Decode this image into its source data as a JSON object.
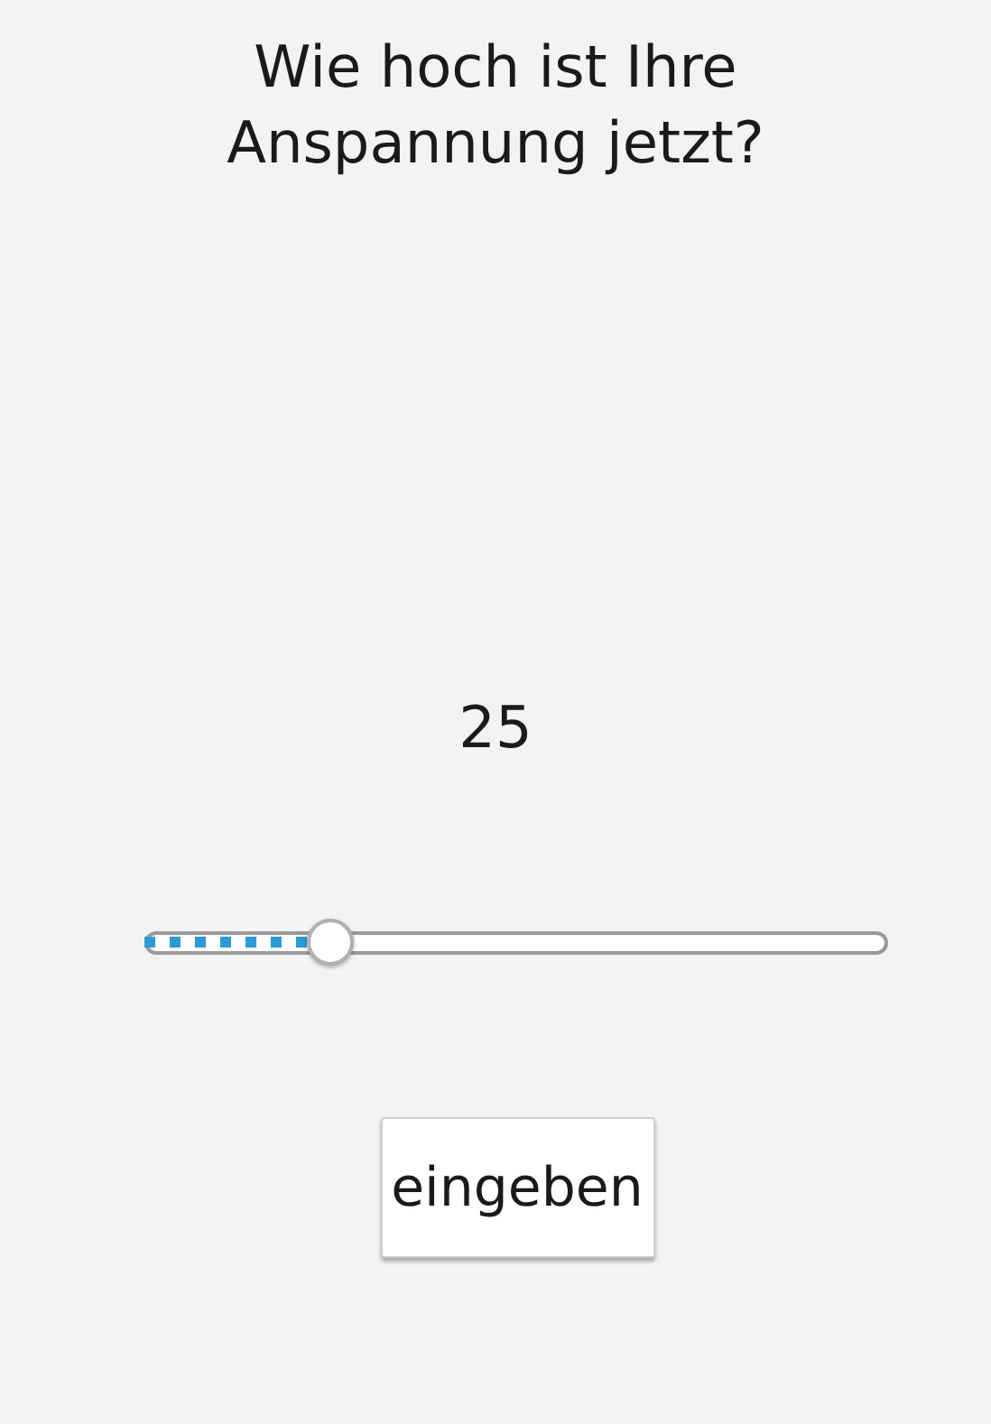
{
  "question": "Wie hoch ist Ihre Anspannung jetzt?",
  "value": "25",
  "slider": {
    "level": 0.25
  },
  "button": "eingeben"
}
